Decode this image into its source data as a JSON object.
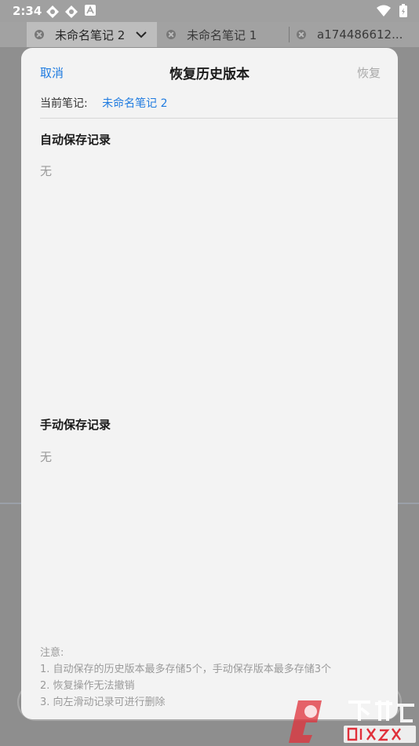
{
  "status_bar": {
    "time": "2:34",
    "left_icons": [
      "app-icon-1",
      "app-icon-2",
      "a-badge-icon"
    ],
    "right_icons": [
      "wifi-icon",
      "battery-icon"
    ]
  },
  "tabs": [
    {
      "label": "未命名笔记 2",
      "active": true
    },
    {
      "label": "未命名笔记 1",
      "active": false
    },
    {
      "label": "a174486612...",
      "active": false
    }
  ],
  "dialog": {
    "cancel_label": "取消",
    "title": "恢复历史版本",
    "restore_label": "恢复",
    "current_label": "当前笔记:",
    "current_note": "未命名笔记 2",
    "auto_section": {
      "title": "自动保存记录",
      "empty": "无"
    },
    "manual_section": {
      "title": "手动保存记录",
      "empty": "无"
    },
    "notes": {
      "heading": "注意:",
      "items": [
        "1. 自动保存的历史版本最多存储5个，手动保存版本最多存储3个",
        "2. 恢复操作无法撤销",
        "3. 向左滑动记录可进行删除"
      ]
    }
  },
  "colors": {
    "accent": "#1f7be0",
    "muted": "#a8a8a8",
    "dialog_bg": "#f3f3f3"
  }
}
